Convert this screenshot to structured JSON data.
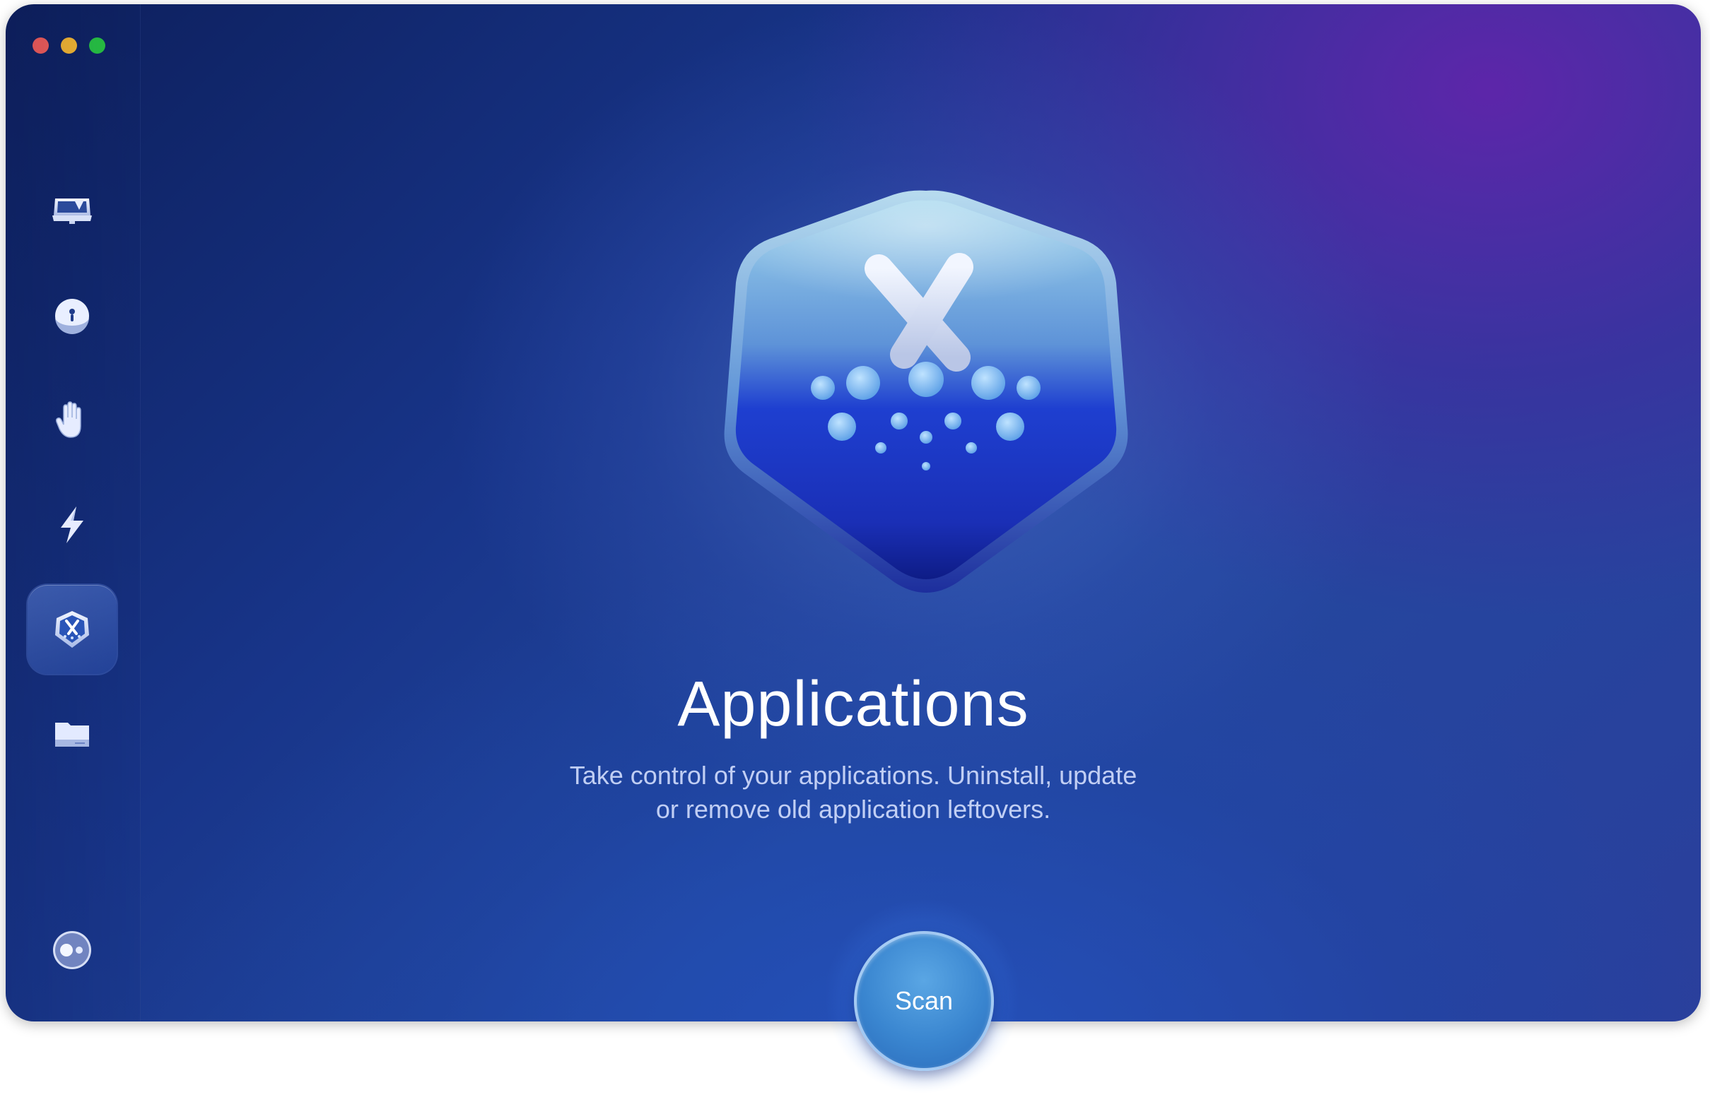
{
  "window": {
    "controls": [
      "close",
      "minimize",
      "maximize"
    ]
  },
  "sidebar": {
    "items": [
      {
        "icon": "monitor-icon",
        "active": false
      },
      {
        "icon": "protection-icon",
        "active": false
      },
      {
        "icon": "hand-icon",
        "active": false
      },
      {
        "icon": "lightning-icon",
        "active": false
      },
      {
        "icon": "applications-icon",
        "active": true
      },
      {
        "icon": "folder-icon",
        "active": false
      }
    ],
    "bottom_icon": "assistant-icon"
  },
  "main": {
    "hero_icon": "applications-hero-icon",
    "title": "Applications",
    "subtitle_line1": "Take control of your applications. Uninstall, update",
    "subtitle_line2": "or remove old application leftovers.",
    "scan_label": "Scan"
  },
  "colors": {
    "accent": "#3a86d0",
    "background_start": "#0d1f5c",
    "background_end": "#5a249e"
  }
}
